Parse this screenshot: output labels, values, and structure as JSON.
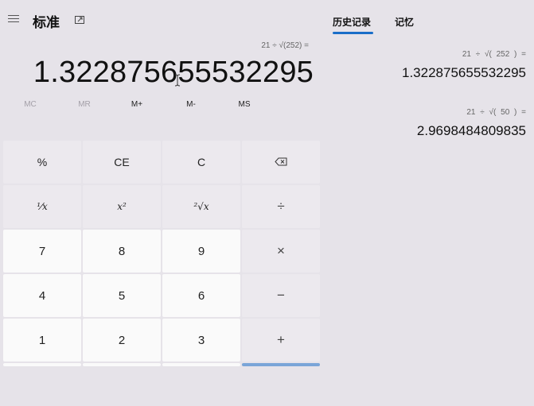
{
  "header": {
    "mode_title": "标准"
  },
  "display": {
    "expression": "21 ÷ √(252) =",
    "result": "1.322875655532295"
  },
  "memory": [
    "MC",
    "MR",
    "M+",
    "M-",
    "MS"
  ],
  "keys": {
    "percent": "%",
    "ce": "CE",
    "c": "C",
    "reciprocal": "¹⁄x",
    "square": "x²",
    "sqrt": "²√x",
    "divide": "÷",
    "seven": "7",
    "eight": "8",
    "nine": "9",
    "multiply": "×",
    "four": "4",
    "five": "5",
    "six": "6",
    "minus": "−",
    "one": "1",
    "two": "2",
    "three": "3",
    "plus": "+"
  },
  "tabs": {
    "history": "历史记录",
    "memory": "记忆"
  },
  "history": [
    {
      "expression": "21 ÷ √( 252 ) =",
      "value": "1.322875655532295"
    },
    {
      "expression": "21 ÷ √( 50 ) =",
      "value": "2.9698484809835"
    }
  ],
  "colors": {
    "accent": "#1a6ec8",
    "background": "#e6e3e9"
  }
}
